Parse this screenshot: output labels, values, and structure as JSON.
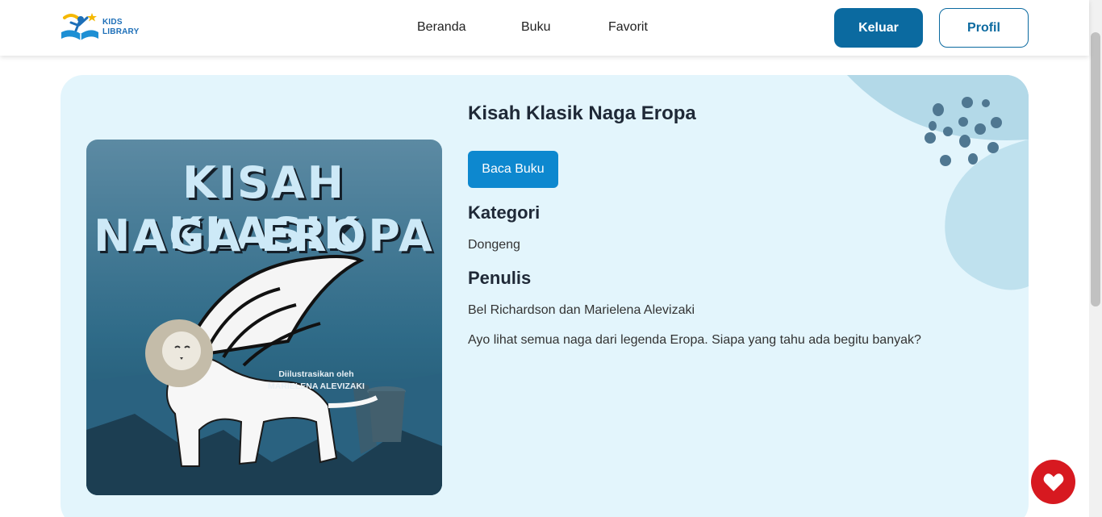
{
  "header": {
    "logo_line1": "KIDS",
    "logo_line2": "LIBRARY",
    "nav": [
      "Beranda",
      "Buku",
      "Favorit"
    ],
    "logout_label": "Keluar",
    "profile_label": "Profil"
  },
  "book": {
    "title": "Kisah Klasik Naga Eropa",
    "read_label": "Baca Buku",
    "category_heading": "Kategori",
    "category": "Dongeng",
    "author_heading": "Penulis",
    "author": "Bel Richardson dan Marielena Alevizaki",
    "description": "Ayo lihat semua naga dari legenda Eropa. Siapa yang tahu ada begitu banyak?",
    "cover": {
      "title_line1": "KISAH KLASIK",
      "title_line2": "NAGA EROPA",
      "credit_line1": "Diilustrasikan oleh",
      "credit_line2": "MARIELENA ALEVIZAKI"
    }
  },
  "icons": {
    "logo": "reading-child-logo-icon",
    "favorite": "heart-icon"
  },
  "colors": {
    "primary": "#0b6aa0",
    "button_blue": "#0d88cf",
    "card_bg": "#e3f5fc",
    "fab_red": "#d71920"
  }
}
